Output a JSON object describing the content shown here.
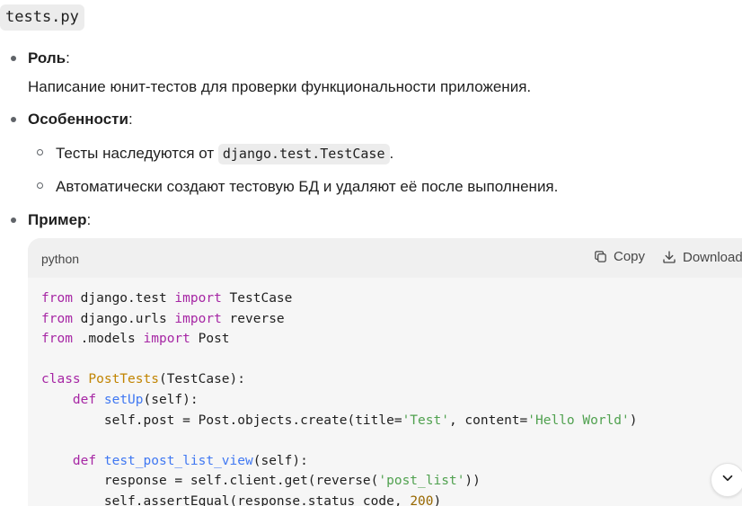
{
  "file_name": "tests.py",
  "sections": {
    "role": {
      "label": "Роль",
      "colon": ":",
      "description": "Написание юнит-тестов для проверки функциональности приложения."
    },
    "features": {
      "label": "Особенности",
      "colon": ":",
      "item1_text": "Тесты наследуются от ",
      "item1_code": "django.test.TestCase",
      "item1_end": ".",
      "item2_text": "Автоматически создают тестовую БД и удаляют её после выполнения."
    },
    "example": {
      "label": "Пример",
      "colon": ":"
    }
  },
  "code_block": {
    "language": "python",
    "copy_label": "Copy",
    "download_label": "Download",
    "lines": [
      "from django.test import TestCase",
      "from django.urls import reverse",
      "from .models import Post",
      "",
      "class PostTests(TestCase):",
      "    def setUp(self):",
      "        self.post = Post.objects.create(title='Test', content='Hello World')",
      "",
      "    def test_post_list_view(self):",
      "        response = self.client.get(reverse('post_list'))",
      "        self.assertEqual(response.status_code, 200)"
    ]
  },
  "icons": {
    "copy": "copy-icon",
    "download": "download-icon",
    "scroll": "chevron-down-icon"
  },
  "colors": {
    "keyword": "#a626a4",
    "function": "#4078f2",
    "class": "#c18401",
    "string": "#50a14f",
    "number": "#986801"
  }
}
